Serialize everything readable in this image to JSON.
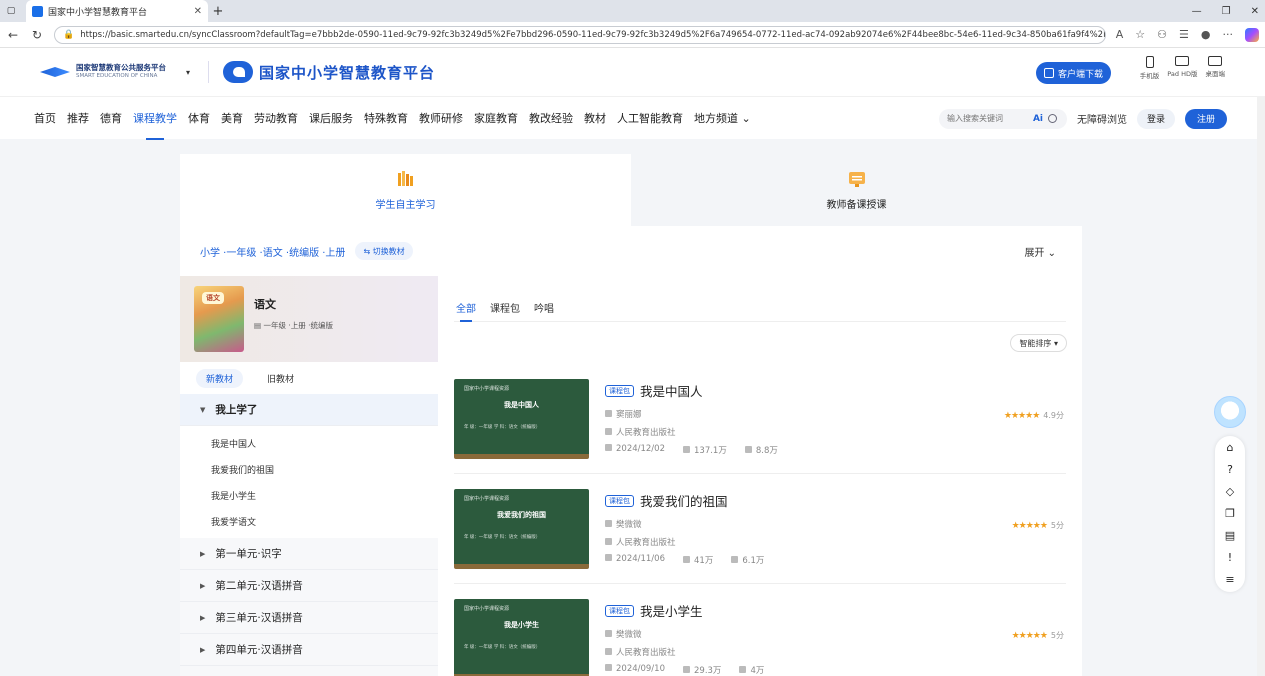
{
  "browser": {
    "tab_title": "国家中小学智慧教育平台",
    "url": "https://basic.smartedu.cn/syncClassroom?defaultTag=e7bbb2de-0590-11ed-9c79-92fc3b3249d5%2Fe7bbd296-0590-11ed-9c79-92fc3b3249d5%2F6a749654-0772-11ed-ac74-092ab92074e6%2F44bee8bc-54e6-11ed-9c34-850ba61fa9f4%2Fff80808..."
  },
  "header": {
    "org_name": "国家智慧教育公共服务平台",
    "org_name_en": "SMART EDUCATION OF CHINA",
    "site_name": "国家中小学智慧教育平台",
    "download_label": "客户端下载",
    "devices": [
      "手机版",
      "Pad HD版",
      "桌面端"
    ]
  },
  "nav": {
    "items": [
      "首页",
      "推荐",
      "德育",
      "课程教学",
      "体育",
      "美育",
      "劳动教育",
      "课后服务",
      "特殊教育",
      "教师研修",
      "家庭教育",
      "教改经验",
      "教材",
      "人工智能教育",
      "地方频道 ⌄"
    ],
    "search_placeholder": "输入搜索关键词",
    "ai_label": "Ai",
    "accessible": "无障碍浏览",
    "login": "登录",
    "register": "注册"
  },
  "modes": [
    {
      "label": "学生自主学习"
    },
    {
      "label": "教师备课授课"
    }
  ],
  "crumb": "小学 ·一年级 ·语文 ·统编版 ·上册",
  "switch_label": "⇆ 切换教材",
  "expand_label": "展开 ⌄",
  "book": {
    "cover_label": "语文",
    "name": "语文",
    "sub": "一年级 ·上册 ·统编版"
  },
  "edition_tabs": [
    "新教材",
    "旧教材"
  ],
  "units": [
    {
      "name": "我上学了",
      "open": true,
      "lessons": [
        "我是中国人",
        "我爱我们的祖国",
        "我是小学生",
        "我爱学语文"
      ]
    },
    {
      "name": "第一单元·识字",
      "open": false,
      "lessons": []
    },
    {
      "name": "第二单元·汉语拼音",
      "open": false,
      "lessons": []
    },
    {
      "name": "第三单元·汉语拼音",
      "open": false,
      "lessons": []
    },
    {
      "name": "第四单元·汉语拼音",
      "open": false,
      "lessons": []
    }
  ],
  "content_tabs": [
    "全部",
    "课程包",
    "吟唱"
  ],
  "sort_label": "智能排序 ▾",
  "cards": [
    {
      "thumb_top": "国家中小学课程资源",
      "thumb_title": "我是中国人",
      "thumb_meta": "年  级：一年级        学  科：语文（统编版）",
      "badge": "课程包",
      "title": "我是中国人",
      "author": "窦丽娜",
      "publisher": "人民教育出版社",
      "date": "2024/12/02",
      "views": "137.1万",
      "likes": "8.8万",
      "stars": "★★★★★",
      "score": "4.9分"
    },
    {
      "thumb_top": "国家中小学课程资源",
      "thumb_title": "我爱我们的祖国",
      "thumb_meta": "年  级：一年级        学  科：语文（统编版）",
      "badge": "课程包",
      "title": "我爱我们的祖国",
      "author": "樊微微",
      "publisher": "人民教育出版社",
      "date": "2024/11/06",
      "views": "41万",
      "likes": "6.1万",
      "stars": "★★★★★",
      "score": "5分"
    },
    {
      "thumb_top": "国家中小学课程资源",
      "thumb_title": "我是小学生",
      "thumb_meta": "年  级：一年级        学  科：语文（统编版）",
      "badge": "课程包",
      "title": "我是小学生",
      "author": "樊微微",
      "publisher": "人民教育出版社",
      "date": "2024/09/10",
      "views": "29.3万",
      "likes": "4万",
      "stars": "★★★★★",
      "score": "5分"
    }
  ],
  "colors": {
    "brand": "#1f62d8",
    "star": "#f0a020"
  }
}
